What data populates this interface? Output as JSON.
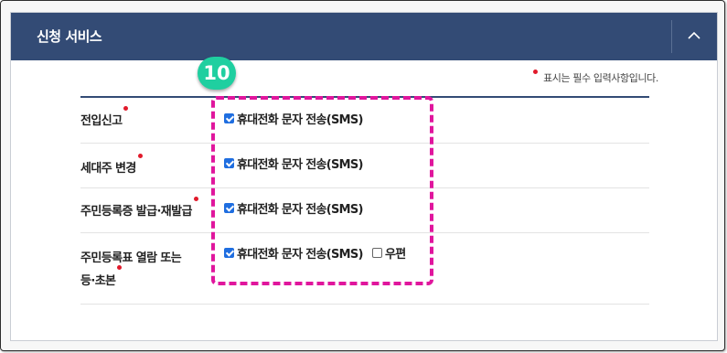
{
  "panel": {
    "title": "신청 서비스",
    "required_note": "표시는 필수 입력사항입니다."
  },
  "step_badge": "10",
  "rows": [
    {
      "label": "전입신고",
      "sms": "휴대전화 문자 전송(SMS)",
      "sms_checked": true
    },
    {
      "label": "세대주 변경",
      "sms": "휴대전화 문자 전송(SMS)",
      "sms_checked": true
    },
    {
      "label": "주민등록증 발급·재발급",
      "sms": "휴대전화 문자 전송(SMS)",
      "sms_checked": true
    },
    {
      "label_line1": "주민등록표 열람 또는",
      "label_line2": "등·초본",
      "sms": "휴대전화 문자 전송(SMS)",
      "sms_checked": true,
      "mail": "우편",
      "mail_checked": false
    }
  ],
  "colors": {
    "header_bg": "#334b75",
    "required_dot": "#e11a2b",
    "checkbox": "#1f6ee0",
    "highlight": "#e0169d",
    "badge": "#1fcfa0"
  },
  "icons": {
    "collapse": "chevron-up-icon"
  }
}
